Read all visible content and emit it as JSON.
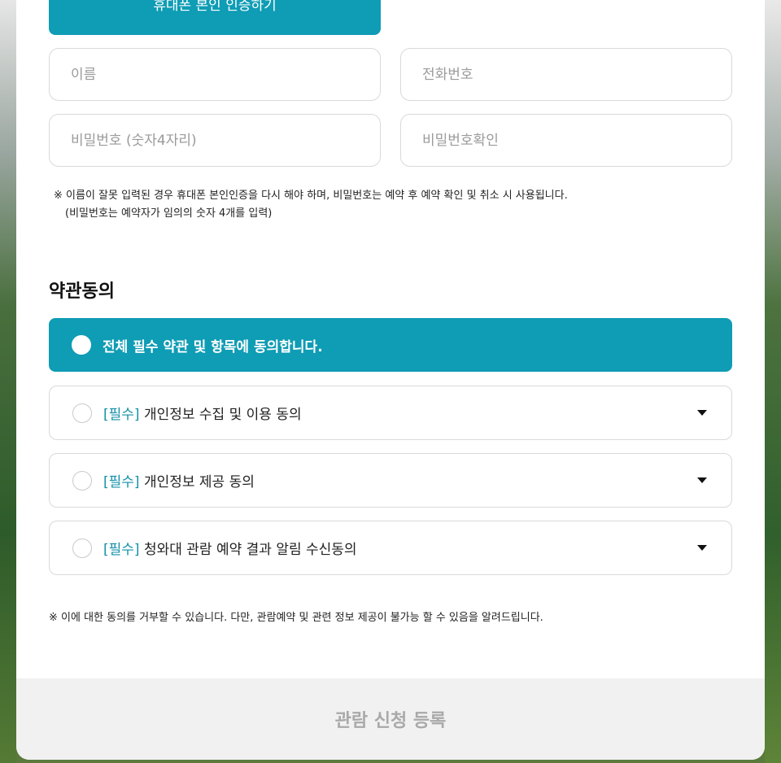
{
  "verify": {
    "button_label": "휴대폰 본인 인증하기"
  },
  "form": {
    "name_placeholder": "이름",
    "phone_placeholder": "전화번호",
    "password_placeholder": "비밀번호 (숫자4자리)",
    "password_confirm_placeholder": "비밀번호확인"
  },
  "notice": {
    "line1": "※ 이름이 잘못 입력된 경우 휴대폰 본인인증을 다시 해야 하며, 비밀번호는 예약 후 예약 확인 및 취소 시 사용됩니다.",
    "line2": "(비밀번호는 예약자가 임의의 숫자 4개를 입력)"
  },
  "terms": {
    "title": "약관동의",
    "all_label": "전체 필수 약관 및 항목에 동의합니다.",
    "items": [
      {
        "tag": "[필수]",
        "label": "개인정보 수집 및 이용 동의"
      },
      {
        "tag": "[필수]",
        "label": "개인정보 제공 동의"
      },
      {
        "tag": "[필수]",
        "label": "청와대 관람 예약 결과 알림 수신동의"
      }
    ],
    "footnote": "※ 이에 대한 동의를 거부할 수 있습니다. 다만, 관람예약 및 관련 정보 제공이 불가능 할 수 있음을 알려드립니다."
  },
  "submit": {
    "label": "관람 신청 등록"
  },
  "colors": {
    "accent": "#0f9cb5",
    "required_tag": "#1391a8",
    "submit_bg": "#f1f1f1"
  }
}
